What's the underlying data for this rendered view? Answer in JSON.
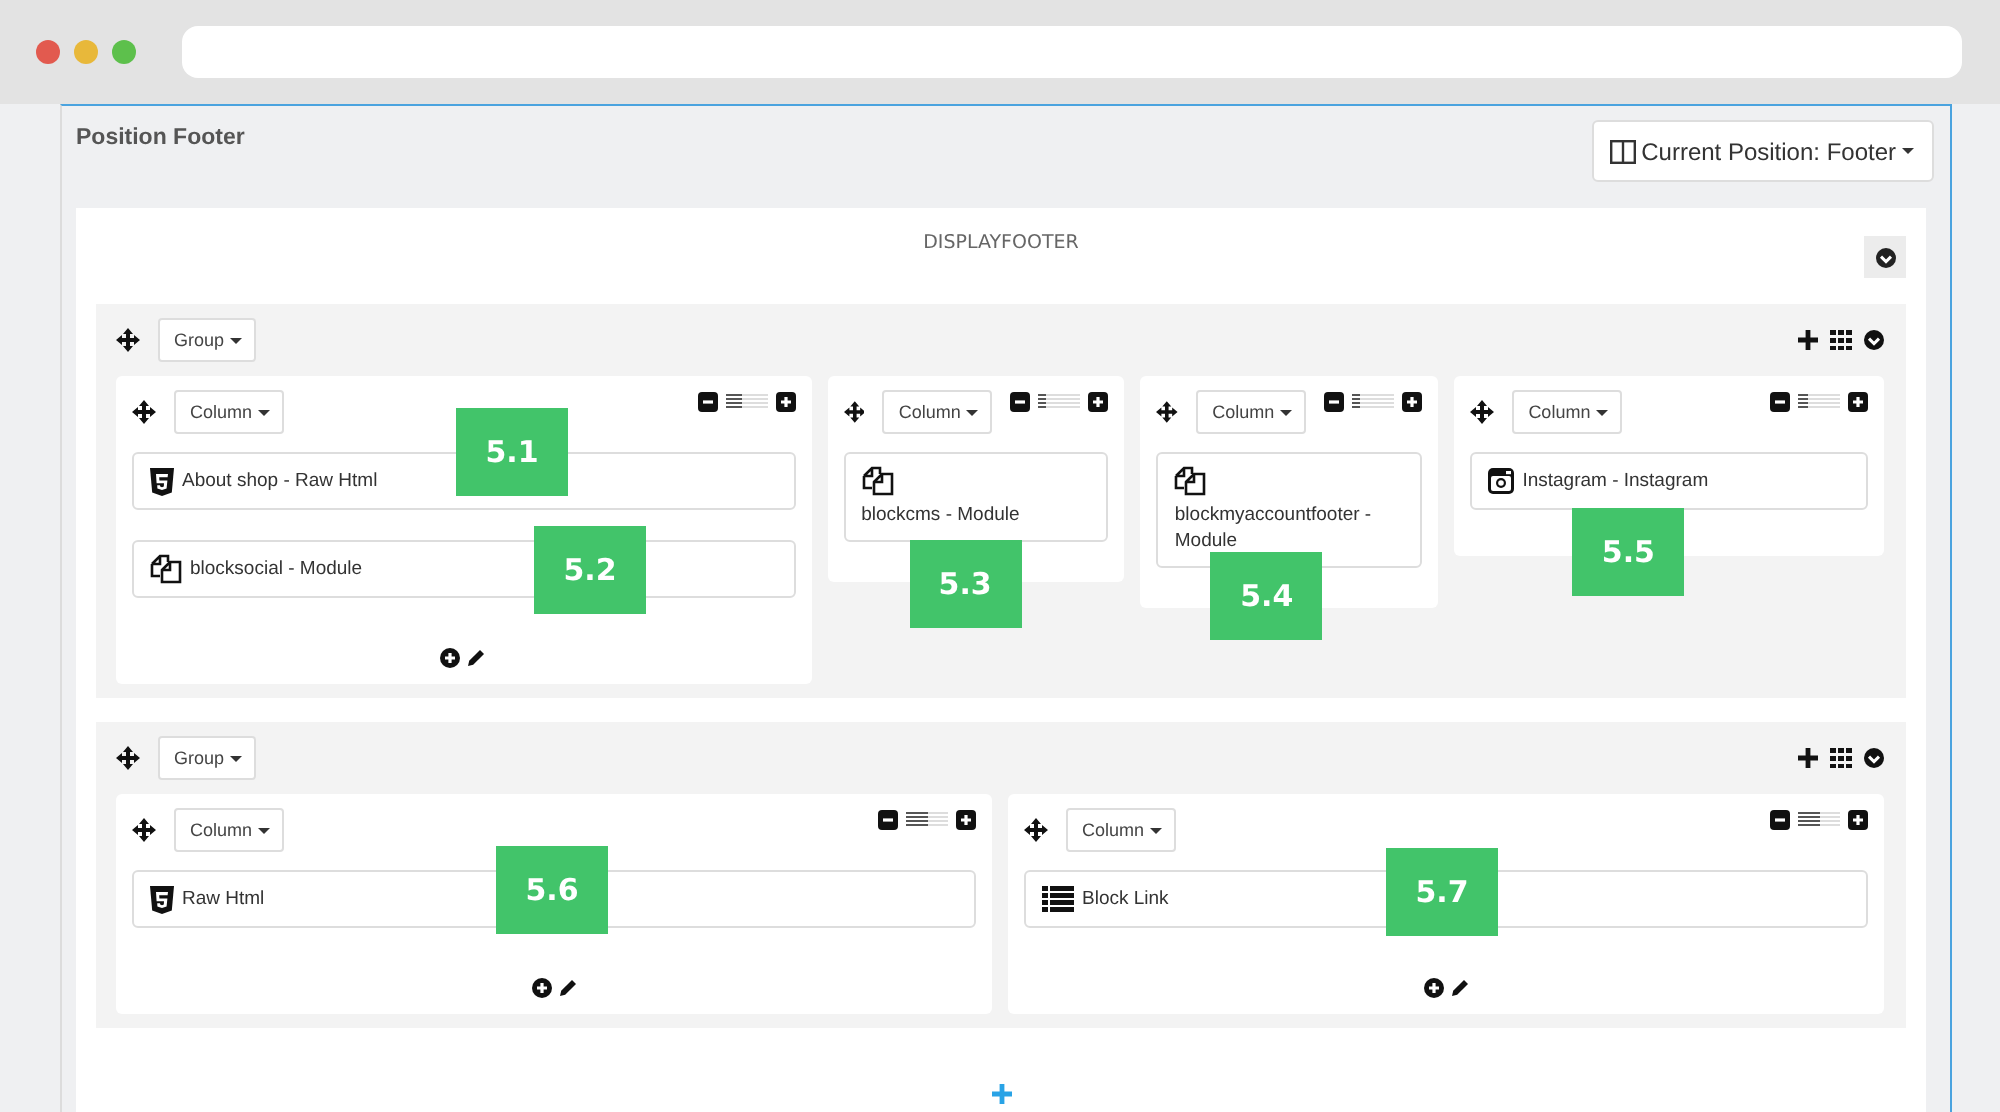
{
  "page": {
    "title": "Position Footer",
    "position_button": "Current Position: Footer"
  },
  "hook": "DISPLAYFOOTER",
  "groups": [
    {
      "label": "Group",
      "columns": [
        {
          "label": "Column",
          "level": 0.417,
          "modules": [
            {
              "kind": "html",
              "text": "About shop - Raw Html",
              "badge": "5.1"
            },
            {
              "kind": "module",
              "text": "blocksocial - Module",
              "badge": "5.2"
            }
          ]
        },
        {
          "label": "Column",
          "level": 0.167,
          "modules": [
            {
              "kind": "module",
              "text": "blockcms - Module",
              "badge": "5.3"
            }
          ]
        },
        {
          "label": "Column",
          "level": 0.167,
          "modules": [
            {
              "kind": "module",
              "text": "blockmyaccountfooter - Module",
              "badge": "5.4"
            }
          ]
        },
        {
          "label": "Column",
          "level": 0.25,
          "modules": [
            {
              "kind": "instagram",
              "text": "Instagram - Instagram",
              "badge": "5.5"
            }
          ]
        }
      ]
    },
    {
      "label": "Group",
      "columns": [
        {
          "label": "Column",
          "level": 0.5,
          "modules": [
            {
              "kind": "html",
              "text": "Raw Html",
              "badge": "5.6"
            }
          ]
        },
        {
          "label": "Column",
          "level": 0.5,
          "modules": [
            {
              "kind": "list",
              "text": "Block Link",
              "badge": "5.7"
            }
          ]
        }
      ]
    }
  ]
}
